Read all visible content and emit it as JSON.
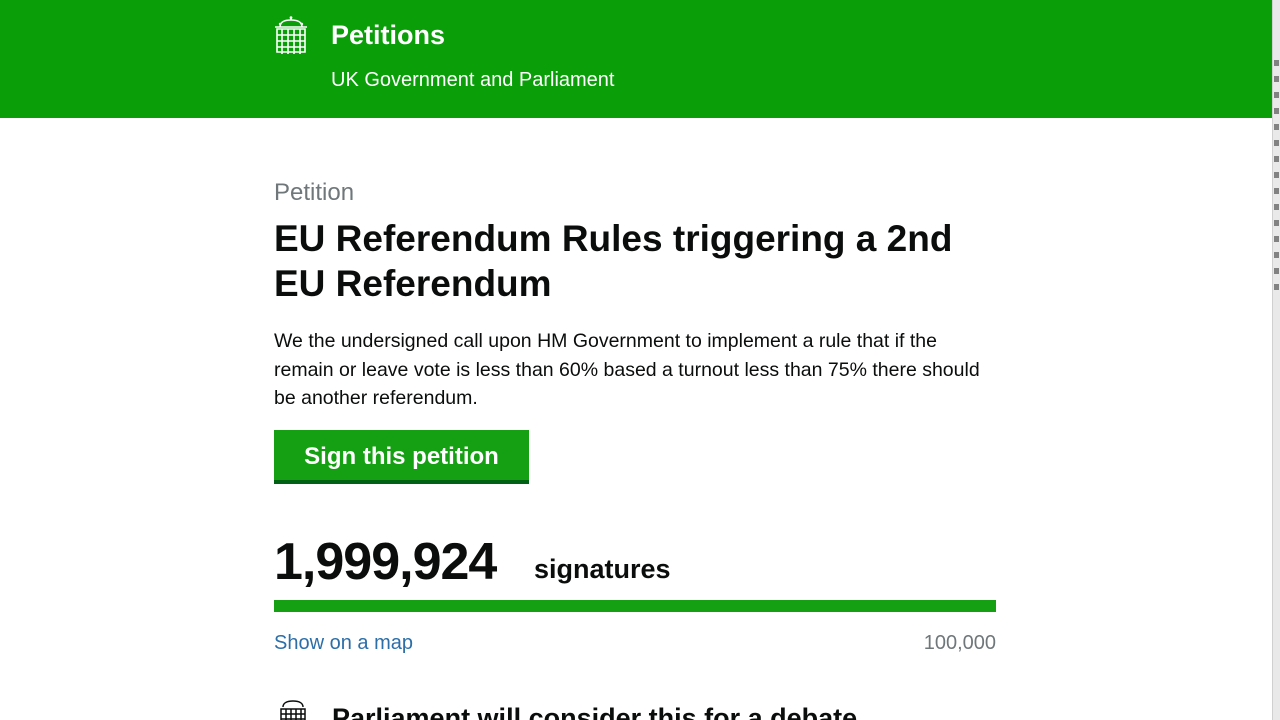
{
  "header": {
    "title": "Petitions",
    "subtitle": "UK Government and Parliament",
    "logo_icon": "portcullis-icon",
    "background_color": "#0a9e08"
  },
  "petition": {
    "eyebrow": "Petition",
    "title": "EU Referendum Rules triggering a 2nd EU Referendum",
    "description": "We the undersigned call upon HM Government to implement a rule that if the remain or leave vote is less than 60% based a turnout less than 75% there should be another referendum.",
    "sign_button_label": "Sign this petition"
  },
  "signatures": {
    "count": "1,999,924",
    "label": "signatures",
    "progress_fraction": 1.0,
    "map_link": "Show on a map",
    "threshold": "100,000"
  },
  "threshold_section": {
    "icon": "portcullis-icon",
    "text": "Parliament will consider this for a debate"
  }
}
